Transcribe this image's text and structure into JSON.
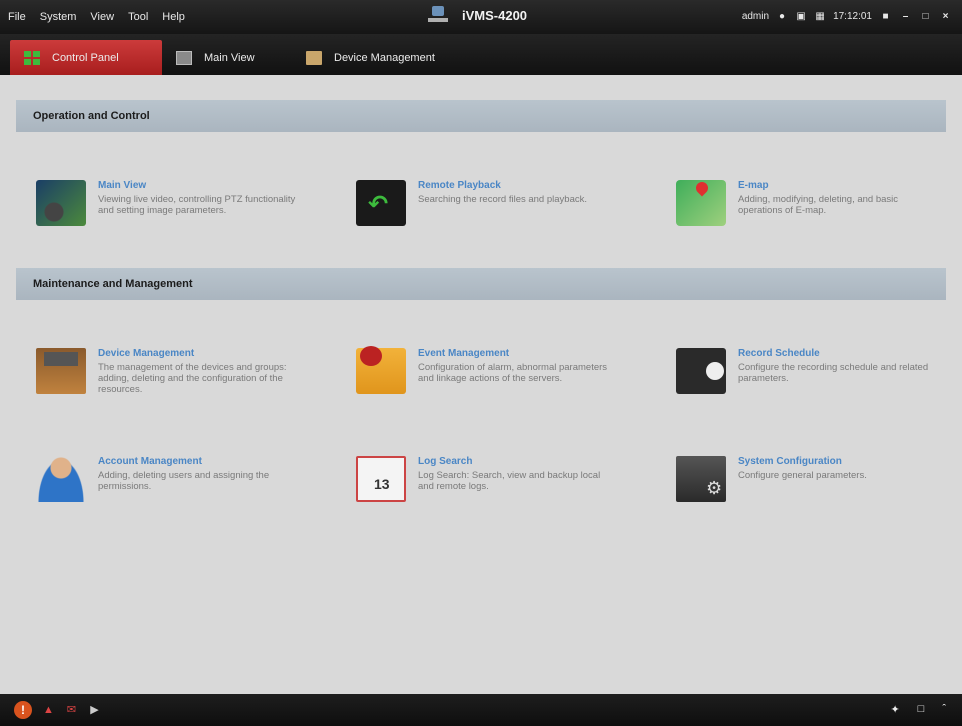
{
  "menu": {
    "items": [
      "File",
      "System",
      "View",
      "Tool",
      "Help"
    ]
  },
  "app": {
    "title": "iVMS-4200"
  },
  "status": {
    "user": "admin",
    "time": "17:12:01"
  },
  "tabs": [
    {
      "label": "Control Panel",
      "active": true
    },
    {
      "label": "Main View",
      "active": false
    },
    {
      "label": "Device Management",
      "active": false
    }
  ],
  "sections": [
    {
      "title": "Operation and Control"
    },
    {
      "title": "Maintenance and Management"
    }
  ],
  "tiles": [
    {
      "title": "Main View",
      "desc": "Viewing live video, controlling PTZ functionality and setting image parameters.",
      "icon": "main-view-icon"
    },
    {
      "title": "Remote Playback",
      "desc": "Searching the record files and playback.",
      "icon": "remote-playback-icon"
    },
    {
      "title": "E-map",
      "desc": "Adding, modifying, deleting, and basic operations of E-map.",
      "icon": "emap-icon"
    },
    {
      "title": "Device Management",
      "desc": "The management of the devices and groups: adding, deleting and the configuration of the resources.",
      "icon": "device-management-icon"
    },
    {
      "title": "Event Management",
      "desc": "Configuration of alarm, abnormal parameters and linkage actions of the servers.",
      "icon": "event-management-icon"
    },
    {
      "title": "Record Schedule",
      "desc": "Configure the recording schedule and related parameters.",
      "icon": "record-schedule-icon"
    },
    {
      "title": "Account Management",
      "desc": "Adding, deleting users and assigning the permissions.",
      "icon": "account-management-icon"
    },
    {
      "title": "Log Search",
      "desc": "Log Search: Search, view and backup local and remote logs.",
      "icon": "log-search-icon"
    },
    {
      "title": "System Configuration",
      "desc": "Configure general parameters.",
      "icon": "system-configuration-icon"
    }
  ]
}
